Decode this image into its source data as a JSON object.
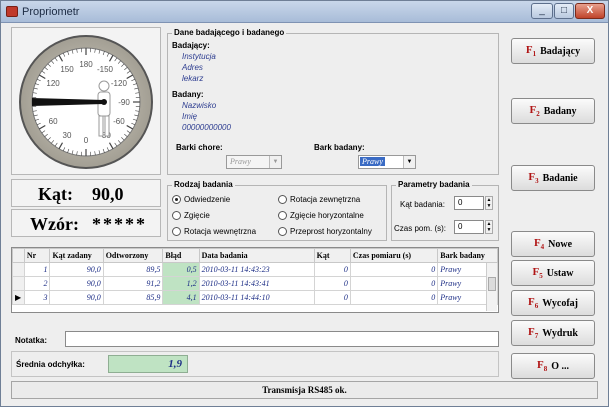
{
  "window": {
    "title": "Propriometr",
    "controls": [
      "_",
      "□",
      "X"
    ]
  },
  "gauge": {
    "ticks": [
      "180",
      "150",
      "120",
      "90",
      "60",
      "30",
      "0",
      "-30",
      "-60",
      "-90",
      "-120",
      "-150"
    ],
    "angle": 90
  },
  "kat": {
    "label": "Kąt:",
    "value": "90,0"
  },
  "wzor": {
    "label": "Wzór:",
    "value": "*****"
  },
  "dane": {
    "title": "Dane badającego i badanego",
    "badajacy_label": "Badający:",
    "badajacy": [
      "Instytucja",
      "Adres",
      "lekarz"
    ],
    "badany_label": "Badany:",
    "badany": [
      "Nazwisko",
      "Imię",
      "00000000000"
    ],
    "barki_chore_label": "Barki chore:",
    "barki_chore_value": "Prawy",
    "bark_badany_label": "Bark badany:",
    "bark_badany_value": "Prawy"
  },
  "rodzaj": {
    "title": "Rodzaj badania",
    "options": [
      "Odwiedzenie",
      "Zgięcie",
      "Rotacja wewnętrzna",
      "Rotacja zewnętrzna",
      "Zgięcie horyzontalne",
      "Przeprost horyzontalny"
    ],
    "selected": "Odwiedzenie"
  },
  "parametry": {
    "title": "Parametry badania",
    "kat_label": "Kąt badania:",
    "kat_value": "0",
    "czas_label": "Czas pom. (s):",
    "czas_value": "0"
  },
  "fbuttons": [
    {
      "key": "F",
      "num": "1",
      "label": "Badający"
    },
    {
      "key": "F",
      "num": "2",
      "label": "Badany"
    },
    {
      "key": "F",
      "num": "3",
      "label": "Badanie"
    },
    {
      "key": "F",
      "num": "4",
      "label": "Nowe"
    },
    {
      "key": "F",
      "num": "5",
      "label": "Ustaw"
    },
    {
      "key": "F",
      "num": "6",
      "label": "Wycofaj"
    },
    {
      "key": "F",
      "num": "7",
      "label": "Wydruk"
    },
    {
      "key": "F",
      "num": "8",
      "label": "O ..."
    }
  ],
  "table": {
    "headers": [
      "Nr",
      "Kąt zadany",
      "Odtworzony",
      "Błąd",
      "Data badania",
      "Kąt",
      "Czas pomiaru (s)",
      "Bark badany"
    ],
    "rows": [
      [
        "1",
        "90,0",
        "89,5",
        "0,5",
        "2010-03-11 14:43:23",
        "0",
        "0",
        "Prawy"
      ],
      [
        "2",
        "90,0",
        "91,2",
        "1,2",
        "2010-03-11 14:43:41",
        "0",
        "0",
        "Prawy"
      ],
      [
        "3",
        "90,0",
        "85,9",
        "4,1",
        "2010-03-11 14:44:10",
        "0",
        "0",
        "Prawy"
      ]
    ]
  },
  "notatka": {
    "label": "Notatka:",
    "value": ""
  },
  "srednia": {
    "label": "Średnia odchyłka:",
    "value": "1,9"
  },
  "status": "Transmisja RS485 ok."
}
